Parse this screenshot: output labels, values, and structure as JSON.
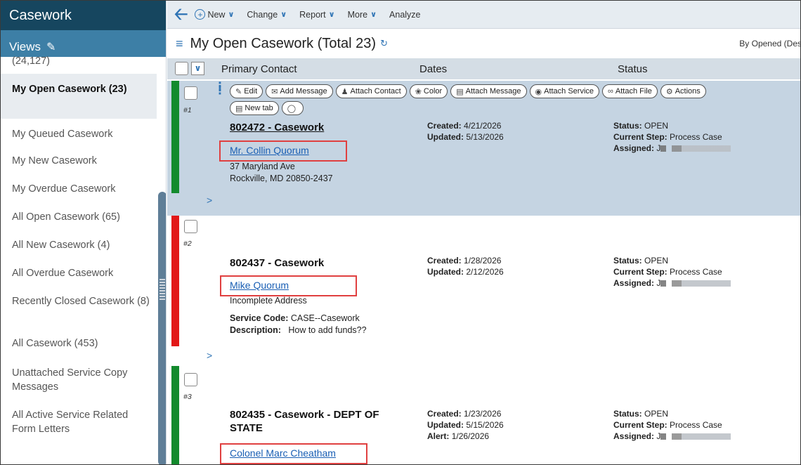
{
  "sidebar": {
    "app_title": "Casework",
    "views_label": "Views",
    "items": [
      {
        "label": "(24,127)"
      },
      {
        "label": "My Open Casework (23)",
        "selected": true
      },
      {
        "label": "My Queued Casework"
      },
      {
        "label": "My New Casework"
      },
      {
        "label": "My Overdue Casework"
      },
      {
        "label": "All Open Casework (65)"
      },
      {
        "label": "All New Casework (4)"
      },
      {
        "label": "All Overdue Casework"
      },
      {
        "label": "Recently Closed Casework (8)"
      },
      {
        "label": "All Casework (453)"
      },
      {
        "label": "Unattached Service Copy Messages"
      },
      {
        "label": "All Active Service Related Form Letters"
      }
    ]
  },
  "toolbar": {
    "new_label": "New",
    "change_label": "Change",
    "report_label": "Report",
    "more_label": "More",
    "analyze_label": "Analyze"
  },
  "list": {
    "title": "My Open Casework (Total 23)",
    "sort_label": "By Opened (Des",
    "columns": [
      "Primary Contact",
      "Dates",
      "Status"
    ]
  },
  "actions": {
    "row1": [
      "Edit",
      "Add Message",
      "Attach Contact",
      "Color",
      "Attach Message",
      "Attach Service",
      "Attach File",
      "Actions"
    ],
    "new_tab": "New tab"
  },
  "records": [
    {
      "num": "#1",
      "title": "802472 - Casework",
      "contact": "Mr. Collin Quorum",
      "address1": "37 Maryland Ave",
      "address2": "Rockville, MD 20850-2437",
      "created_label": "Created:",
      "created": "4/21/2026",
      "updated_label": "Updated:",
      "updated": "5/13/2026",
      "status_label": "Status:",
      "status": "OPEN",
      "step_label": "Current Step:",
      "step": "Process Case",
      "assigned_label": "Assigned:",
      "assigned": "J"
    },
    {
      "num": "#2",
      "title": "802437 - Casework",
      "contact": "Mike Quorum",
      "address1": "Incomplete Address",
      "service_code_label": "Service Code:",
      "service_code": "CASE--Casework",
      "description_label": "Description:",
      "description": "How to add funds??",
      "created_label": "Created:",
      "created": "1/28/2026",
      "updated_label": "Updated:",
      "updated": "2/12/2026",
      "status_label": "Status:",
      "status": "OPEN",
      "step_label": "Current Step:",
      "step": "Process Case",
      "assigned_label": "Assigned:",
      "assigned": "J"
    },
    {
      "num": "#3",
      "title_line1": "802435 - Casework - DEPT OF",
      "title_line2": "STATE",
      "contact": "Colonel Marc Cheatham",
      "created_label": "Created:",
      "created": "1/23/2026",
      "updated_label": "Updated:",
      "updated": "5/15/2026",
      "alert_label": "Alert:",
      "alert": "1/26/2026",
      "status_label": "Status:",
      "status": "OPEN",
      "step_label": "Current Step:",
      "step": "Process Case",
      "assigned_label": "Assigned:",
      "assigned": "J"
    }
  ],
  "expand_glyph": ">",
  "colors": {
    "header": "#16465f",
    "views": "#3d7fa6",
    "selected_row": "#c5d4e2",
    "green": "#138a2d",
    "red": "#e21818",
    "link": "#1a5fb4",
    "highlight": "#e04040"
  }
}
